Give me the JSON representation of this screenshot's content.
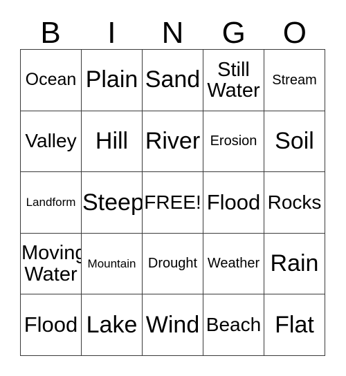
{
  "card": {
    "title_letters": [
      "B",
      "I",
      "N",
      "G",
      "O"
    ],
    "free_space_label": "FREE!",
    "border_color": "#3a3a3a",
    "text_color": "#000000",
    "background_color": "#ffffff",
    "rows": 5,
    "columns": 5,
    "cells": [
      [
        {
          "label": "Ocean",
          "size": "fs-m",
          "wraps": false
        },
        {
          "label": "Plain",
          "size": "fs-xxl",
          "wraps": false
        },
        {
          "label": "Sand",
          "size": "fs-xxl",
          "wraps": false
        },
        {
          "label": "Still\nWater",
          "size": "two-line",
          "wraps": true
        },
        {
          "label": "Stream",
          "size": "fs-s",
          "wraps": false
        }
      ],
      [
        {
          "label": "Valley",
          "size": "fs-l",
          "wraps": false
        },
        {
          "label": "Hill",
          "size": "fs-xxl",
          "wraps": false
        },
        {
          "label": "River",
          "size": "fs-xxl",
          "wraps": false
        },
        {
          "label": "Erosion",
          "size": "fs-s",
          "wraps": false
        },
        {
          "label": "Soil",
          "size": "fs-xxl",
          "wraps": false
        }
      ],
      [
        {
          "label": "Landform",
          "size": "fs-xs",
          "wraps": false
        },
        {
          "label": "Steep",
          "size": "fs-xxl",
          "wraps": false
        },
        {
          "label": "FREE!",
          "size": "fs-l",
          "wraps": false
        },
        {
          "label": "Flood",
          "size": "fs-xl",
          "wraps": false
        },
        {
          "label": "Rocks",
          "size": "fs-l",
          "wraps": false
        }
      ],
      [
        {
          "label": "Moving\nWater",
          "size": "two-line",
          "wraps": true
        },
        {
          "label": "Mountain",
          "size": "fs-xs",
          "wraps": false
        },
        {
          "label": "Drought",
          "size": "fs-s",
          "wraps": false
        },
        {
          "label": "Weather",
          "size": "fs-s",
          "wraps": false
        },
        {
          "label": "Rain",
          "size": "fs-xxl",
          "wraps": false
        }
      ],
      [
        {
          "label": "Flood",
          "size": "fs-xl",
          "wraps": false
        },
        {
          "label": "Lake",
          "size": "fs-xxl",
          "wraps": false
        },
        {
          "label": "Wind",
          "size": "fs-xxl",
          "wraps": false
        },
        {
          "label": "Beach",
          "size": "fs-l",
          "wraps": false
        },
        {
          "label": "Flat",
          "size": "fs-xxl",
          "wraps": false
        }
      ]
    ]
  }
}
